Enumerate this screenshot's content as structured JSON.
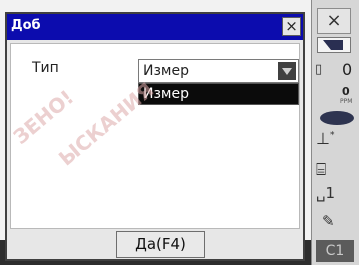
{
  "dialog": {
    "title": "Доб",
    "close_glyph": "×",
    "type_label": "Тип",
    "combo_value": "Измер",
    "combo_option": "Измер",
    "ok_button": "Да(F4)"
  },
  "status_bar": {
    "close_glyph": "×",
    "prism_constant": "0",
    "ppm_value": "0",
    "ppm_unit": "PPM",
    "level_glyph": "⊥",
    "level_star": "*",
    "instrument_glyph": "⛭",
    "memory_glyph": "1",
    "edit_glyph": "✎",
    "bottom_label": "C1"
  },
  "watermarks": [
    "ЗЕНО!",
    "ЫСКАНИЯ"
  ],
  "colors": {
    "titlebar": "#0c0cae",
    "selection": "#0b0b0b",
    "status_bg": "#d6d6d6"
  }
}
